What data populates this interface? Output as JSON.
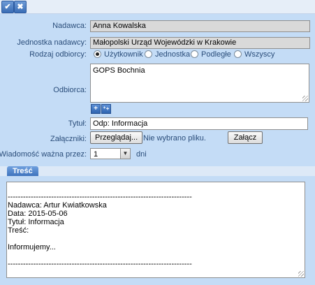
{
  "toolbar": {
    "accept_icon": "checkmark-icon",
    "cancel_icon": "close-icon"
  },
  "form": {
    "sender_label": "Nadawca:",
    "sender_value": "Anna Kowalska",
    "unit_label": "Jednostka nadawcy:",
    "unit_value": "Małopolski Urząd Wojewódzki w Krakowie",
    "recipient_type_label": "Rodzaj odbiorcy:",
    "recipient_types": [
      {
        "label": "Użytkownik",
        "selected": true
      },
      {
        "label": "Jednostka",
        "selected": false
      },
      {
        "label": "Podległe",
        "selected": false
      },
      {
        "label": "Wszyscy",
        "selected": false
      }
    ],
    "recipients_label": "Odbiorca:",
    "recipients_value": "GOPS Bochnia",
    "add_icon": "plus-icon",
    "add_multi_icon": "multi-add-icon",
    "title_label": "Tytuł:",
    "title_value": "Odp: Informacja",
    "attachments_label": "Załączniki:",
    "browse_label": "Przeglądaj...",
    "no_file_text": "Nie wybrano pliku.",
    "attach_label": "Załącz",
    "valid_label": "Wiadomość ważna przez:",
    "valid_value": "1",
    "valid_unit": "dni"
  },
  "content": {
    "tab_label": "Treść",
    "lines": [
      "",
      "------------------------------------------------------------------------",
      "Nadawca: Artur Kwiatkowska",
      "Data: 2015-05-06",
      "Tytuł: Informacja",
      "Treść:",
      "",
      "Informujemy...",
      "",
      "------------------------------------------------------------------------"
    ]
  },
  "colors": {
    "panel": "#c4dcf6",
    "background": "#dde9f7",
    "accent": "#3f73bd"
  }
}
